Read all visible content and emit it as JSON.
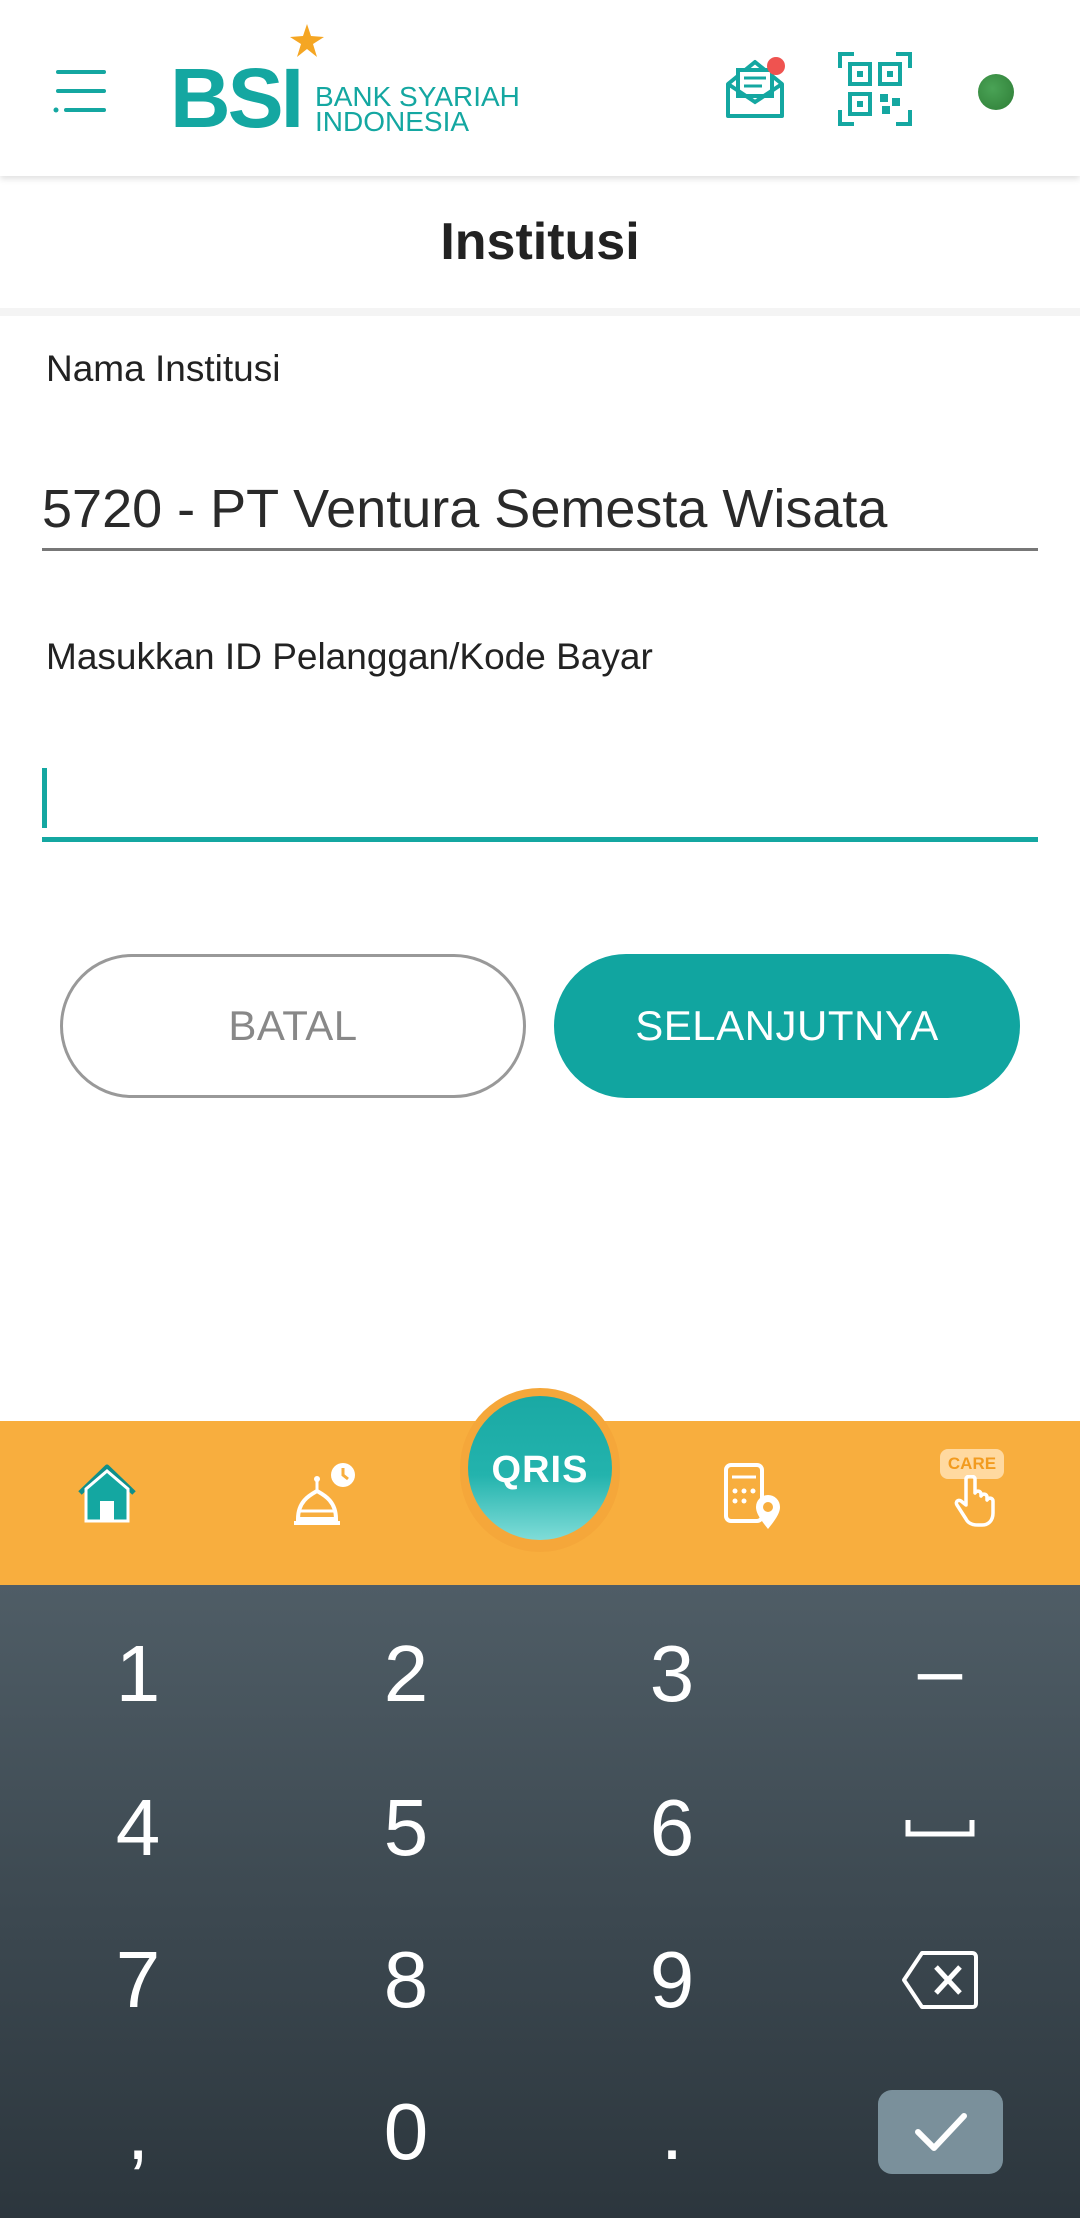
{
  "header": {
    "logo": {
      "mark": "BSI",
      "line1": "BANK SYARIAH",
      "line2": "INDONESIA"
    },
    "icons": [
      "menu-icon",
      "inbox-icon",
      "qr-scan-icon",
      "status-dot"
    ],
    "colors": {
      "brand": "#14a7a1",
      "accent": "#f8ae3e",
      "status": "#3a8f45"
    }
  },
  "page": {
    "title": "Institusi"
  },
  "form": {
    "institution_label": "Nama Institusi",
    "institution_value": "5720 - PT Ventura Semesta Wisata",
    "customer_id_label": "Masukkan ID Pelanggan/Kode Bayar",
    "customer_id_value": ""
  },
  "buttons": {
    "cancel": "BATAL",
    "next": "SELANJUTNYA"
  },
  "bottom_nav": {
    "items": [
      "home-icon",
      "prayer-time-icon",
      "qris-icon",
      "atm-locator-icon",
      "care-icon"
    ],
    "qris_label": "QRIS",
    "care_label": "CARE"
  },
  "keyboard": {
    "rows": [
      [
        "1",
        "2",
        "3",
        "–"
      ],
      [
        "4",
        "5",
        "6",
        "space"
      ],
      [
        "7",
        "8",
        "9",
        "backspace"
      ],
      [
        ",",
        "0",
        ".",
        "enter"
      ]
    ],
    "keys": {
      "k1": "1",
      "k2": "2",
      "k3": "3",
      "dash": "–",
      "k4": "4",
      "k5": "5",
      "k6": "6",
      "k7": "7",
      "k8": "8",
      "k9": "9",
      "comma": ",",
      "k0": "0",
      "dot": "."
    }
  }
}
